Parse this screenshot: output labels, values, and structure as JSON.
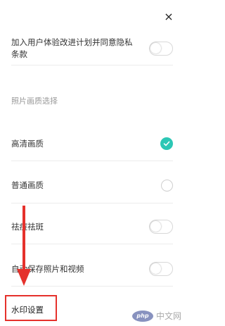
{
  "close_glyph": "×",
  "rows": {
    "join_program": {
      "label": "加入用户体验改进计划并同意隐私条款",
      "toggle_on": false
    },
    "section_title": "照片画质选择",
    "hd_quality": {
      "label": "高清画质",
      "selected": true
    },
    "normal_quality": {
      "label": "普通画质",
      "selected": false
    },
    "blemish": {
      "label": "祛痘祛斑",
      "toggle_on": false
    },
    "autosave": {
      "label": "自动保存照片和视频",
      "toggle_on": false
    },
    "watermark_setting": {
      "label": "水印设置"
    }
  },
  "watermark": {
    "logo": "php",
    "text": "中文网"
  },
  "colors": {
    "accent": "#2cc7b5",
    "annotation_red": "#e5312c"
  }
}
